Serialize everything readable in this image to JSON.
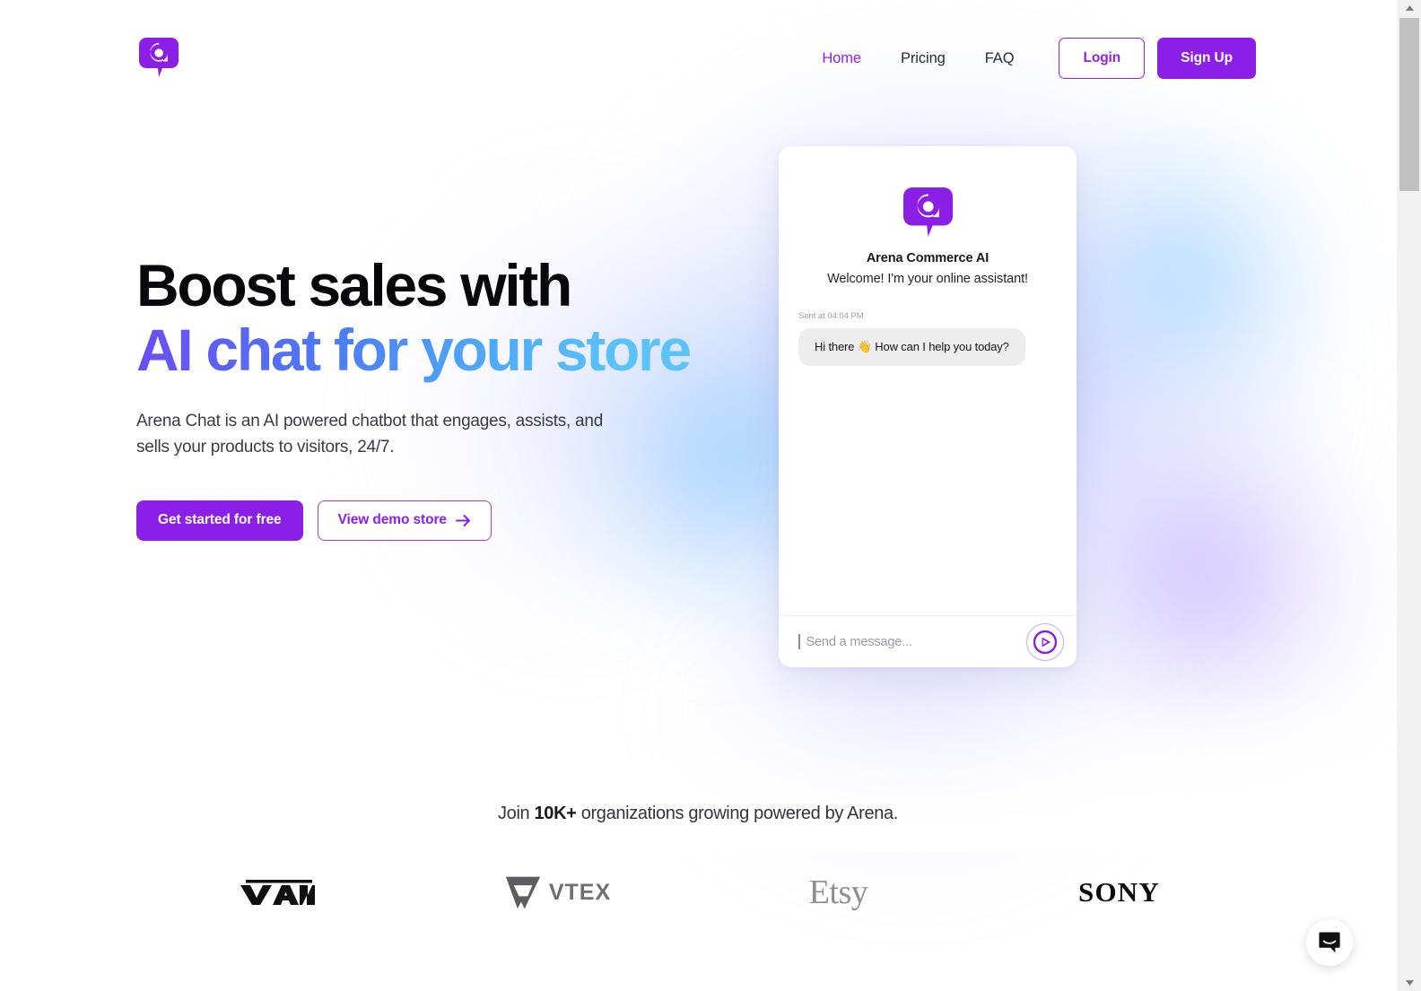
{
  "brand": {
    "name": "Arena",
    "logo_icon": "arena-chat-logo-icon",
    "accent_purple": "#8b1fe8",
    "accent_purple_light": "#9022e8"
  },
  "header": {
    "nav": [
      {
        "label": "Home",
        "active": true
      },
      {
        "label": "Pricing",
        "active": false
      },
      {
        "label": "FAQ",
        "active": false
      }
    ],
    "login_label": "Login",
    "signup_label": "Sign Up"
  },
  "hero": {
    "headline_line1": "Boost sales with",
    "headline_gradient": "AI chat for your store",
    "subheadline": "Arena Chat is an AI powered chatbot that engages, assists, and sells your products to visitors, 24/7.",
    "primary_cta": "Get started for free",
    "secondary_cta": "View demo store",
    "secondary_cta_icon": "arrow-right-icon"
  },
  "chat_widget": {
    "avatar_icon": "arena-chat-logo-icon",
    "title": "Arena Commerce AI",
    "welcome": "Welcome! I'm your online assistant!",
    "timestamp": "Sent at 04:04 PM",
    "message": "Hi there 👋 How can I help you today?",
    "input_placeholder": "Send a message...",
    "send_icon": "send-play-icon"
  },
  "social_proof": {
    "text_before": "Join ",
    "count": "10K+",
    "text_after": " organizations growing powered by Arena.",
    "logos": [
      {
        "name": "VANS",
        "icon": "vans-logo-icon"
      },
      {
        "name": "VTEX",
        "icon": "vtex-logo-icon"
      },
      {
        "name": "Etsy",
        "icon": "etsy-logo-icon"
      },
      {
        "name": "SONY",
        "icon": "sony-logo-icon"
      }
    ]
  },
  "launcher": {
    "icon": "intercom-messenger-icon"
  },
  "scrollbar": {
    "up_icon": "scroll-up-arrow-icon",
    "down_icon": "scroll-down-arrow-icon"
  }
}
